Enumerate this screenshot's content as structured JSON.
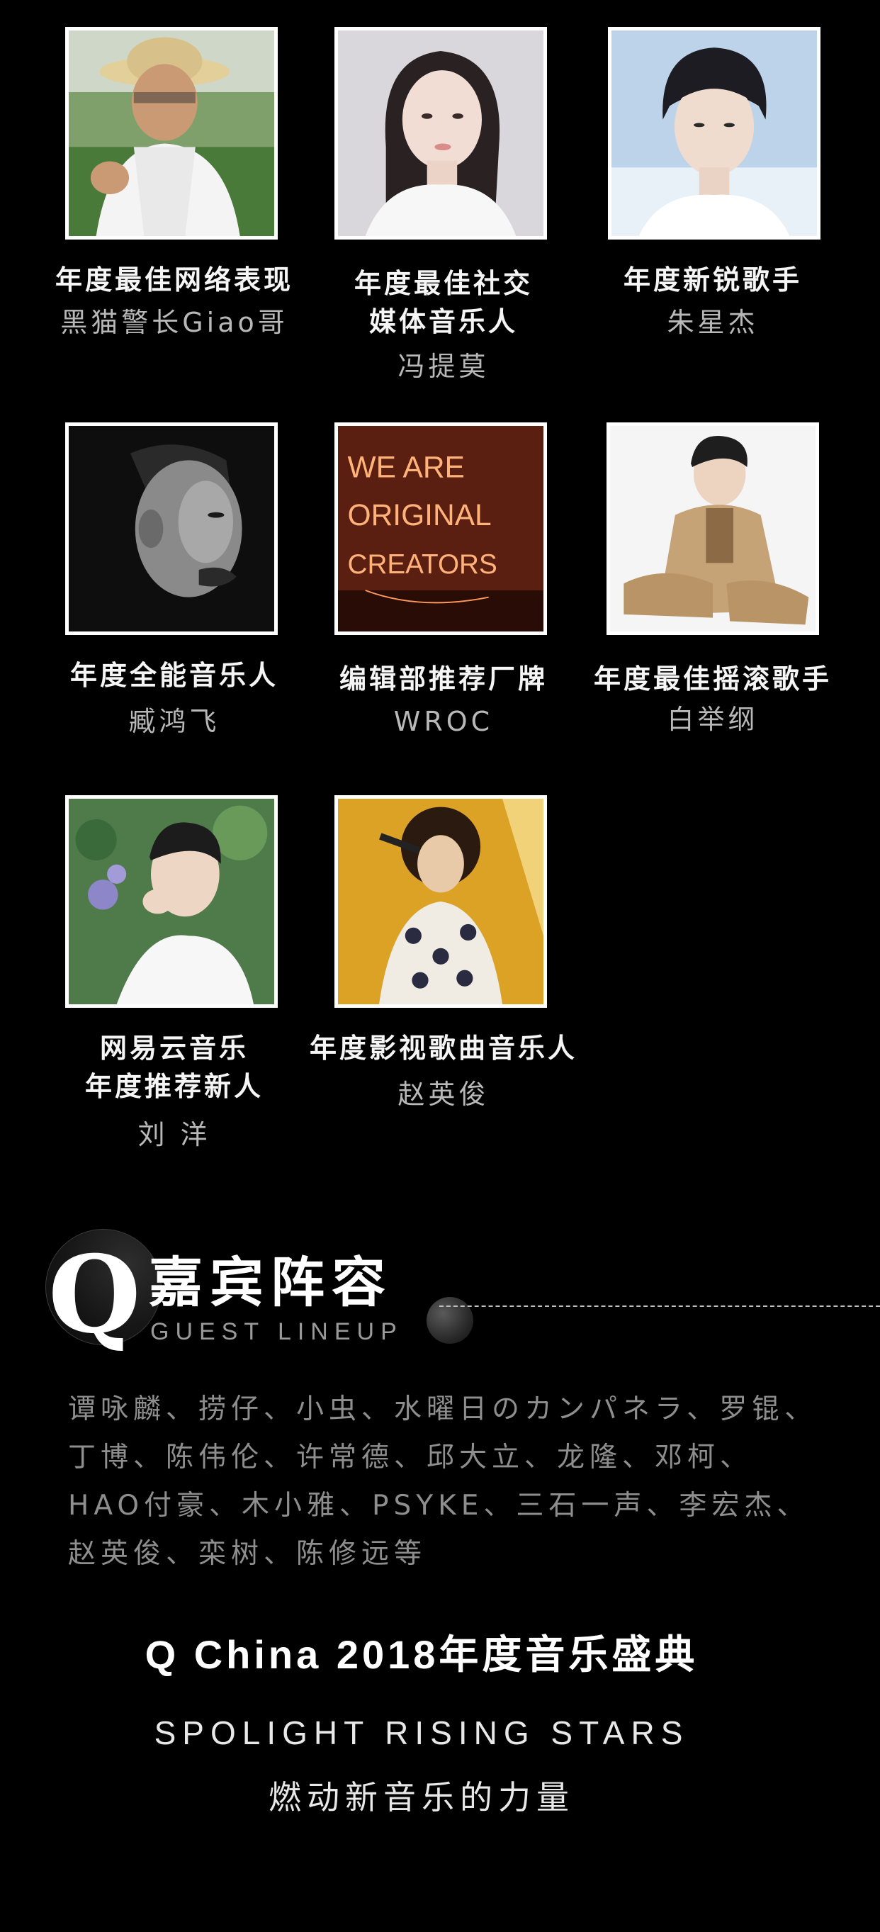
{
  "awards": [
    {
      "title_lines": [
        "年度最佳网络表现"
      ],
      "name": "黑猫警长Giao哥",
      "photo": "photo-man-straw-hat"
    },
    {
      "title_lines": [
        "年度最佳社交",
        "媒体音乐人"
      ],
      "name": "冯提莫",
      "photo": "photo-woman-portrait"
    },
    {
      "title_lines": [
        "年度新锐歌手"
      ],
      "name": "朱星杰",
      "photo": "photo-young-man-blue"
    },
    {
      "title_lines": [
        "年度全能音乐人"
      ],
      "name": "臧鸿飞",
      "photo": "photo-bw-man-profile"
    },
    {
      "title_lines": [
        "编辑部推荐厂牌"
      ],
      "name": "WROC",
      "photo": "photo-neon-sign",
      "neon_lines": [
        "WE ARE",
        "ORIGINAL",
        "CREATORS"
      ]
    },
    {
      "title_lines": [
        "年度最佳摇滚歌手"
      ],
      "name": "白举纲",
      "photo": "photo-man-trench-coat"
    },
    {
      "title_lines": [
        "网易云音乐",
        "年度推荐新人"
      ],
      "name": "刘 洋",
      "photo": "photo-man-flowers"
    },
    {
      "title_lines": [
        "年度影视歌曲音乐人"
      ],
      "name": "赵英俊",
      "photo": "photo-singer-stage"
    }
  ],
  "lineup": {
    "q_mark": "Q",
    "title": "嘉宾阵容",
    "subtitle": "GUEST LINEUP"
  },
  "guests_lines": [
    "谭咏麟、捞仔、小虫、水曜日のカンパネラ、罗锟、",
    "丁博、陈伟伦、许常德、邱大立、龙隆、邓柯、",
    "HAO付豪、木小雅、PSYKE、三石一声、李宏杰、",
    "赵英俊、栾树、陈修远等"
  ],
  "event_title": "Q China 2018年度音乐盛典",
  "slogan_en": "SPOLIGHT RISING STARS",
  "slogan_cn": "燃动新音乐的力量",
  "colors": {
    "background": "#000000",
    "neon": "#ff7a3a",
    "name_gray": "#b8b8b8"
  }
}
